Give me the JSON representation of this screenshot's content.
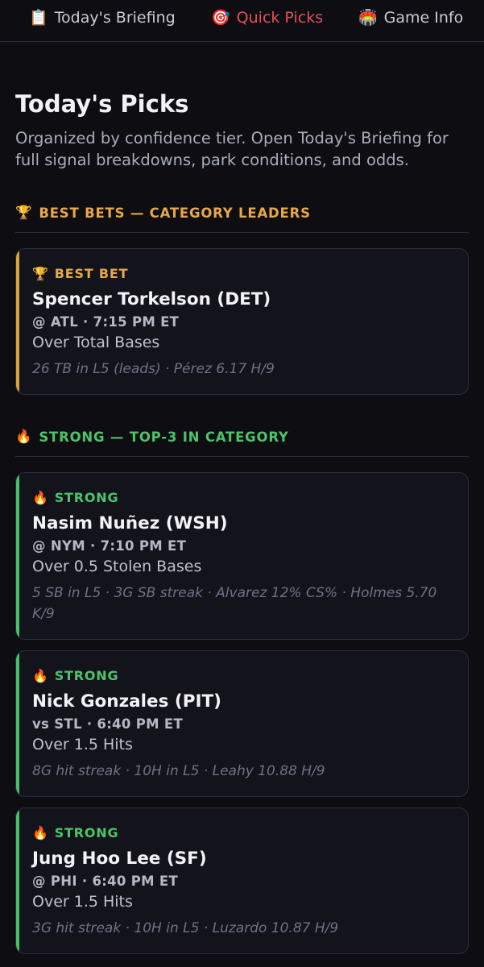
{
  "nav": {
    "tabs": [
      {
        "icon": "📋",
        "label": "Today's Briefing"
      },
      {
        "icon": "🎯",
        "label": "Quick Picks"
      },
      {
        "icon": "🏟️",
        "label": "Game Info"
      }
    ],
    "active": "Quick Picks"
  },
  "page": {
    "title": "Today's Picks",
    "subtitle": "Organized by confidence tier. Open Today's Briefing for full signal breakdowns, park conditions, and odds."
  },
  "sections": [
    {
      "icon": "🏆",
      "label": "BEST BETS — CATEGORY LEADERS",
      "cards": [
        {
          "tier_icon": "🏆",
          "tier": "BEST BET",
          "player": "Spencer Torkelson (DET)",
          "matchup": "@ ATL · 7:15 PM ET",
          "prop": "Over Total Bases",
          "signals": "26 TB in L5 (leads) · Pérez 6.17 H/9"
        }
      ]
    },
    {
      "icon": "🔥",
      "label": "STRONG — TOP-3 IN CATEGORY",
      "cards": [
        {
          "tier_icon": "🔥",
          "tier": "STRONG",
          "player": "Nasim Nuñez (WSH)",
          "matchup": "@ NYM · 7:10 PM ET",
          "prop": "Over 0.5 Stolen Bases",
          "signals": "5 SB in L5 · 3G SB streak · Alvarez 12% CS% · Holmes 5.70 K/9"
        },
        {
          "tier_icon": "🔥",
          "tier": "STRONG",
          "player": "Nick Gonzales (PIT)",
          "matchup": "vs STL · 6:40 PM ET",
          "prop": "Over 1.5 Hits",
          "signals": "8G hit streak · 10H in L5 · Leahy 10.88 H/9"
        },
        {
          "tier_icon": "🔥",
          "tier": "STRONG",
          "player": "Jung Hoo Lee (SF)",
          "matchup": "@ PHI · 6:40 PM ET",
          "prop": "Over 1.5 Hits",
          "signals": "3G hit streak · 10H in L5 · Luzardo 10.87 H/9"
        }
      ]
    }
  ],
  "colors": {
    "background": "#0d0d12",
    "active_tab": "#e0525a",
    "best_bet_accent": "#e6a84a",
    "strong_accent": "#4cc46a"
  }
}
